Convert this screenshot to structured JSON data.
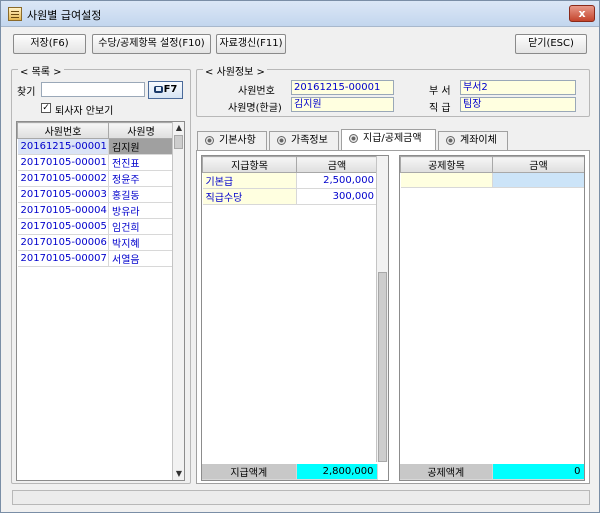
{
  "window": {
    "title": "사원별 급여설정",
    "close_label": "x"
  },
  "toolbar": {
    "save": "저장(F6)",
    "allowance_setup": "수당/공제항목 설정(F10)",
    "refresh": "자료갱신(F11)",
    "close": "닫기(ESC)"
  },
  "list_panel": {
    "group_label": "목록",
    "search_label": "찾기",
    "search_value": "",
    "search_button": "F7",
    "show_retired_label": "퇴사자 안보기",
    "show_retired_checked": true,
    "columns": [
      "사원번호",
      "사원명"
    ],
    "rows": [
      {
        "id": "20161215-00001",
        "name": "김지원",
        "selected": true
      },
      {
        "id": "20170105-00001",
        "name": "전진표"
      },
      {
        "id": "20170105-00002",
        "name": "정윤주"
      },
      {
        "id": "20170105-00003",
        "name": "홍길동"
      },
      {
        "id": "20170105-00004",
        "name": "방유라"
      },
      {
        "id": "20170105-00005",
        "name": "임건희"
      },
      {
        "id": "20170105-00006",
        "name": "박지혜"
      },
      {
        "id": "20170105-00007",
        "name": "서열음"
      }
    ]
  },
  "employee_info": {
    "group_label": "사원정보",
    "emp_no_label": "사원번호",
    "emp_no": "20161215-00001",
    "name_label": "사원명(한글)",
    "name": "김지원",
    "dept_label": "부 서",
    "dept": "부서2",
    "rank_label": "직 급",
    "rank": "팀장"
  },
  "tabs": [
    {
      "label": "기본사항",
      "active": false
    },
    {
      "label": "가족정보",
      "active": false
    },
    {
      "label": "지급/공제금액",
      "active": true
    },
    {
      "label": "계좌이체",
      "active": false
    }
  ],
  "pay_grid": {
    "columns": [
      "지급항목",
      "금액"
    ],
    "rows": [
      {
        "item": "기본급",
        "amount": "2,500,000"
      },
      {
        "item": "직급수당",
        "amount": "300,000"
      }
    ],
    "total_label": "지급액계",
    "total_value": "2,800,000"
  },
  "deduct_grid": {
    "columns": [
      "공제항목",
      "금액"
    ],
    "rows": [],
    "total_label": "공제액계",
    "total_value": "0"
  },
  "colors": {
    "selected_row": "#a0a0a0",
    "total_highlight": "#00ffff",
    "id_text": "#0000cc"
  }
}
